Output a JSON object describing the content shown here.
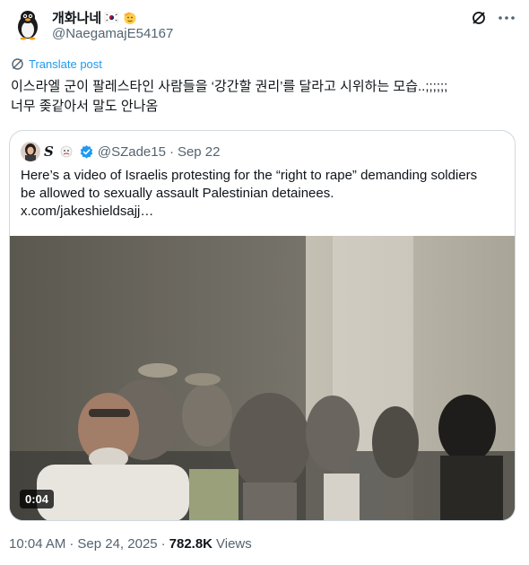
{
  "author": {
    "display_name": "개화나네",
    "handle": "@NaegamajE54167",
    "flag_icon": "south-korea-flag-icon",
    "emoji_icon": "saluting-face-emoji-icon"
  },
  "translate": {
    "label": "Translate post",
    "icon": "globe-icon"
  },
  "post": {
    "line1": "이스라엘 군이 팔레스타인 사람들을 ‘강간할 권리’를 달라고 시위하는 모습..;;;;;;",
    "line2": "너무 좆같아서 말도 안나옴"
  },
  "quote": {
    "display_name": "S",
    "handle": "@SZade15",
    "separator": "·",
    "date": "Sep 22",
    "verified_icon": "verified-badge-icon",
    "text_line1": "Here’s a video of Israelis protesting for the “right to rape” demanding soldiers",
    "text_line2": "be allowed to sexually assault Palestinian detainees.",
    "link": "x.com/jakeshieldsajj…",
    "video_duration": "0:04"
  },
  "meta": {
    "time": "10:04 AM",
    "separator": "·",
    "date": "Sep 24, 2025",
    "views_count": "782.8K",
    "views_label": "Views"
  },
  "colors": {
    "accent": "#1d9bf0",
    "secondary_text": "#536471",
    "border": "#cfd9de"
  }
}
